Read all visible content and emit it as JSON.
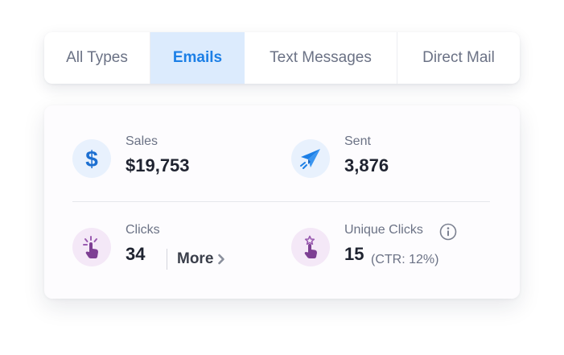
{
  "tabs": [
    {
      "label": "All Types",
      "active": false
    },
    {
      "label": "Emails",
      "active": true
    },
    {
      "label": "Text Messages",
      "active": false
    },
    {
      "label": "Direct Mail",
      "active": false
    }
  ],
  "colors": {
    "accent": "#1c7fe6",
    "active_tab_bg": "#dcebfd",
    "muted_text": "#6b7285",
    "value_text": "#1f2330",
    "icon_bg_blue": "#e8f1fd",
    "icon_bg_purple": "#f4e8f7",
    "icon_purple": "#7d3f93"
  },
  "stats": {
    "sales": {
      "label": "Sales",
      "value": "$19,753",
      "icon": "dollar-icon"
    },
    "sent": {
      "label": "Sent",
      "value": "3,876",
      "icon": "paper-plane-icon"
    },
    "clicks": {
      "label": "Clicks",
      "value": "34",
      "icon": "pointer-click-icon",
      "more_label": "More"
    },
    "unique_clicks": {
      "label": "Unique Clicks",
      "value": "15",
      "ctr": "(CTR: 12%)",
      "icon": "pointer-star-icon",
      "info_icon": "info-icon"
    }
  }
}
